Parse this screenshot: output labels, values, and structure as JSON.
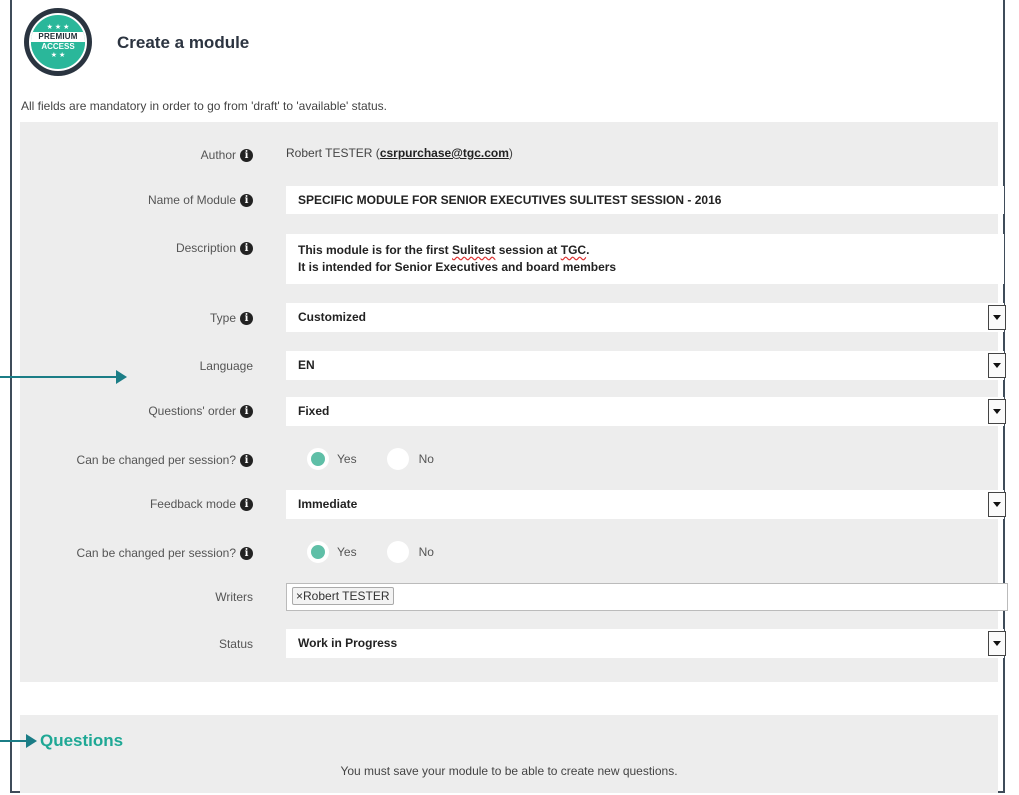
{
  "header": {
    "badge_top": "PREMIUM",
    "badge_bottom": "ACCESS",
    "title": "Create a module"
  },
  "intro": "All fields are mandatory in order to go from 'draft' to 'available' status.",
  "form": {
    "author": {
      "label": "Author",
      "name": "Robert TESTER (",
      "email": "csrpurchase@tgc.com",
      "close": ")"
    },
    "name": {
      "label": "Name of Module",
      "value": "SPECIFIC MODULE FOR SENIOR EXECUTIVES SULITEST SESSION - 2016"
    },
    "description": {
      "label": "Description",
      "line1_a": "This module is for the first ",
      "line1_b": "Sulitest",
      "line1_c": " session at ",
      "line1_d": "TGC",
      "line1_e": ".",
      "line2": "It is intended for Senior Executives and board members"
    },
    "type": {
      "label": "Type",
      "value": "Customized"
    },
    "language": {
      "label": "Language",
      "value": "EN"
    },
    "questions_order": {
      "label": "Questions' order",
      "value": "Fixed"
    },
    "order_changeable": {
      "label": "Can be changed per session?",
      "yes": "Yes",
      "no": "No",
      "selected": "Yes"
    },
    "feedback": {
      "label": "Feedback mode",
      "value": "Immediate"
    },
    "feedback_changeable": {
      "label": "Can be changed per session?",
      "yes": "Yes",
      "no": "No",
      "selected": "Yes"
    },
    "writers": {
      "label": "Writers",
      "tags": [
        "Robert TESTER"
      ],
      "tag_remove": "×"
    },
    "status": {
      "label": "Status",
      "value": "Work in Progress"
    }
  },
  "questions": {
    "title": "Questions",
    "message": "You must save your module to be able to create new questions."
  },
  "colors": {
    "accent": "#1fa895",
    "radio_on": "#5fbfa7",
    "arrow": "#1b7d86",
    "panel": "#ededed"
  }
}
